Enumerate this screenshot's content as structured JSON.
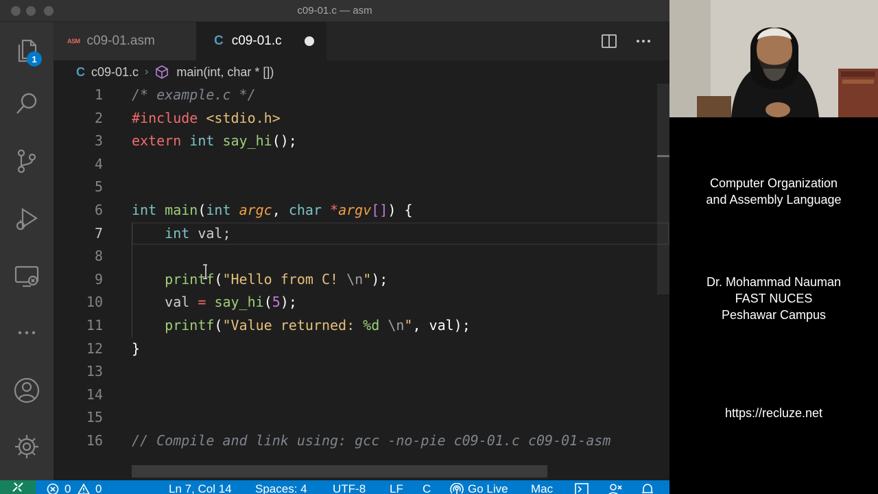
{
  "window": {
    "title": "c09-01.c — asm"
  },
  "activity_bar": {
    "explorer_badge": "1",
    "items": [
      "explorer-icon",
      "search-icon",
      "source-control-icon",
      "run-debug-icon",
      "remote-explorer-icon",
      "more-icon",
      "account-icon",
      "settings-gear-icon"
    ]
  },
  "tabs": [
    {
      "icon_text": "ASM",
      "label": "c09-01.asm",
      "active": false
    },
    {
      "icon_text": "C",
      "label": "c09-01.c",
      "active": true,
      "dirty": true
    }
  ],
  "tab_actions": [
    "split-editor-icon",
    "more-actions-icon"
  ],
  "breadcrumb": {
    "file_icon": "C",
    "file": "c09-01.c",
    "symbol": "main(int, char * [])"
  },
  "editor": {
    "active_line": 7,
    "lines": [
      {
        "n": "1",
        "tokens": [
          {
            "t": "/* example.c */",
            "c": "cmg"
          }
        ]
      },
      {
        "n": "2",
        "tokens": [
          {
            "t": "#include",
            "c": "pp"
          },
          {
            "t": " ",
            "c": "id"
          },
          {
            "t": "<stdio.h>",
            "c": "inc"
          }
        ]
      },
      {
        "n": "3",
        "tokens": [
          {
            "t": "extern",
            "c": "pp"
          },
          {
            "t": " ",
            "c": "id"
          },
          {
            "t": "int",
            "c": "kw"
          },
          {
            "t": " ",
            "c": "id"
          },
          {
            "t": "say_hi",
            "c": "fn"
          },
          {
            "t": "();",
            "c": "pr"
          }
        ]
      },
      {
        "n": "4",
        "tokens": []
      },
      {
        "n": "5",
        "tokens": []
      },
      {
        "n": "6",
        "tokens": [
          {
            "t": "int",
            "c": "kw"
          },
          {
            "t": " ",
            "c": "id"
          },
          {
            "t": "main",
            "c": "fn"
          },
          {
            "t": "(",
            "c": "pr"
          },
          {
            "t": "int",
            "c": "kw"
          },
          {
            "t": " ",
            "c": "id"
          },
          {
            "t": "argc",
            "c": "pa"
          },
          {
            "t": ", ",
            "c": "pr"
          },
          {
            "t": "char",
            "c": "kw"
          },
          {
            "t": " ",
            "c": "id"
          },
          {
            "t": "*",
            "c": "op"
          },
          {
            "t": "argv",
            "c": "pa"
          },
          {
            "t": "[]",
            "c": "brk"
          },
          {
            "t": ") {",
            "c": "pr"
          }
        ]
      },
      {
        "n": "7",
        "indent": true,
        "tokens": [
          {
            "t": "    ",
            "c": "id"
          },
          {
            "t": "int",
            "c": "kw"
          },
          {
            "t": " val;",
            "c": "id"
          }
        ]
      },
      {
        "n": "8",
        "indent": true,
        "tokens": []
      },
      {
        "n": "9",
        "indent": true,
        "tokens": [
          {
            "t": "    ",
            "c": "id"
          },
          {
            "t": "printf",
            "c": "fn"
          },
          {
            "t": "(",
            "c": "pr"
          },
          {
            "t": "\"Hello from C! ",
            "c": "str"
          },
          {
            "t": "\\n",
            "c": "esc"
          },
          {
            "t": "\"",
            "c": "str"
          },
          {
            "t": ");",
            "c": "pr"
          }
        ]
      },
      {
        "n": "10",
        "indent": true,
        "tokens": [
          {
            "t": "    ",
            "c": "id"
          },
          {
            "t": "val",
            "c": "id"
          },
          {
            "t": " ",
            "c": "id"
          },
          {
            "t": "=",
            "c": "op"
          },
          {
            "t": " ",
            "c": "id"
          },
          {
            "t": "say_hi",
            "c": "fn"
          },
          {
            "t": "(",
            "c": "pr"
          },
          {
            "t": "5",
            "c": "num"
          },
          {
            "t": ");",
            "c": "pr"
          }
        ]
      },
      {
        "n": "11",
        "indent": true,
        "tokens": [
          {
            "t": "    ",
            "c": "id"
          },
          {
            "t": "printf",
            "c": "fn"
          },
          {
            "t": "(",
            "c": "pr"
          },
          {
            "t": "\"Value returned: ",
            "c": "str"
          },
          {
            "t": "%d",
            "c": "fmt"
          },
          {
            "t": " ",
            "c": "str"
          },
          {
            "t": "\\n",
            "c": "esc"
          },
          {
            "t": "\"",
            "c": "str"
          },
          {
            "t": ", val);",
            "c": "pr"
          }
        ]
      },
      {
        "n": "12",
        "tokens": [
          {
            "t": "}",
            "c": "pr"
          }
        ]
      },
      {
        "n": "13",
        "tokens": []
      },
      {
        "n": "14",
        "tokens": []
      },
      {
        "n": "15",
        "tokens": []
      },
      {
        "n": "16",
        "tokens": [
          {
            "t": "// Compile and link using: gcc -no-pie c09-01.c c09-01-asm",
            "c": "cmg"
          }
        ]
      }
    ]
  },
  "status_bar": {
    "errors": "0",
    "warnings": "0",
    "cursor_position": "Ln 7, Col 14",
    "indentation": "Spaces: 4",
    "encoding": "UTF-8",
    "eol": "LF",
    "language": "C",
    "live_server": "Go Live",
    "extra": "Mac"
  },
  "side_panel": {
    "course_line1": "Computer Organization",
    "course_line2": "and Assembly Language",
    "instructor": "Dr. Mohammad Nauman",
    "institution": "FAST NUCES",
    "campus": "Peshawar Campus",
    "website": "https://recluze.net"
  },
  "colors": {
    "editor_bg": "#1e1e1e",
    "activity_bar_bg": "#333333",
    "status_bar_bg": "#007acc",
    "remote_bg": "#16825d",
    "badge_bg": "#007acc"
  }
}
